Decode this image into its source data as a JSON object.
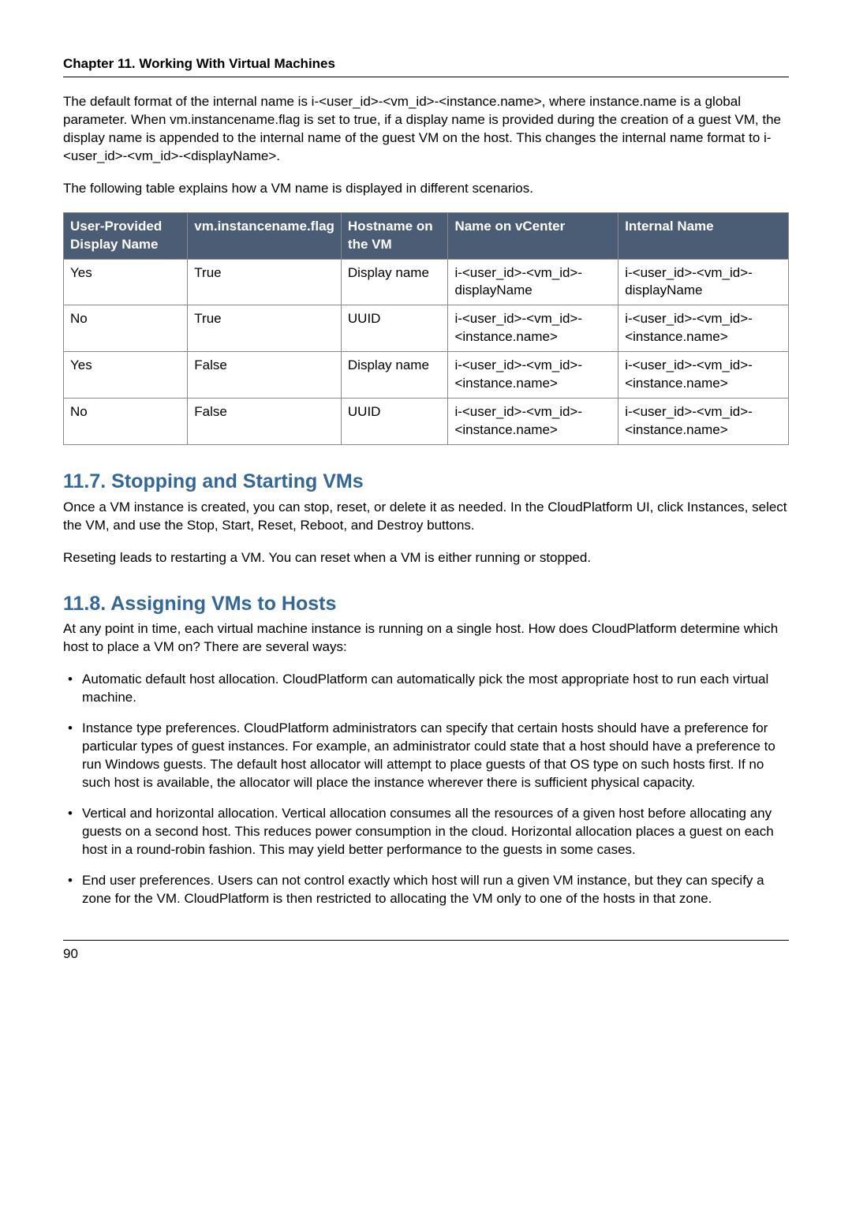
{
  "header": {
    "chapter": "Chapter 11. Working With Virtual Machines"
  },
  "intro": {
    "p1": "The default format of the internal name is i-<user_id>-<vm_id>-<instance.name>, where instance.name is a global parameter. When vm.instancename.flag is set to true, if a display name is provided during the creation of a guest VM, the display name is appended to the internal name of the guest VM on the host. This changes the internal name format to i-<user_id>-<vm_id>-<displayName>.",
    "p2": "The following table explains how a VM name is displayed in different scenarios."
  },
  "table": {
    "headers": {
      "c1": "User-Provided Display Name",
      "c2": "vm.instancename.flag",
      "c3": "Hostname on the VM",
      "c4": "Name on vCenter",
      "c5": "Internal Name"
    },
    "rows": [
      {
        "c1": "Yes",
        "c2": "True",
        "c3": "Display name",
        "c4": "i-<user_id>-<vm_id>-displayName",
        "c5": "i-<user_id>-<vm_id>-displayName"
      },
      {
        "c1": "No",
        "c2": "True",
        "c3": "UUID",
        "c4": "i-<user_id>-<vm_id>-<instance.name>",
        "c5": "i-<user_id>-<vm_id>-<instance.name>"
      },
      {
        "c1": "Yes",
        "c2": "False",
        "c3": "Display name",
        "c4": "i-<user_id>-<vm_id>-<instance.name>",
        "c5": "i-<user_id>-<vm_id>-<instance.name>"
      },
      {
        "c1": "No",
        "c2": "False",
        "c3": "UUID",
        "c4": "i-<user_id>-<vm_id>-<instance.name>",
        "c5": "i-<user_id>-<vm_id>-<instance.name>"
      }
    ]
  },
  "section7": {
    "title": "11.7. Stopping and Starting VMs",
    "p1": "Once a VM instance is created, you can stop, reset, or delete it as needed. In the CloudPlatform UI, click Instances, select the VM, and use the Stop, Start, Reset, Reboot, and Destroy buttons.",
    "p2": "Reseting leads to restarting a VM. You can reset when a VM is either running or stopped."
  },
  "section8": {
    "title": "11.8. Assigning VMs to Hosts",
    "p1": "At any point in time, each virtual machine instance is running on a single host. How does CloudPlatform determine which host to place a VM on? There are several ways:",
    "bullets": [
      "Automatic default host allocation. CloudPlatform can automatically pick the most appropriate host to run each virtual machine.",
      "Instance type preferences. CloudPlatform administrators can specify that certain hosts should have a preference for particular types of guest instances. For example, an administrator could state that a host should have a preference to run Windows guests. The default host allocator will attempt to place guests of that OS type on such hosts first. If no such host is available, the allocator will place the instance wherever there is sufficient physical capacity.",
      "Vertical and horizontal allocation. Vertical allocation consumes all the resources of a given host before allocating any guests on a second host. This reduces power consumption in the cloud. Horizontal allocation places a guest on each host in a round-robin fashion. This may yield better performance to the guests in some cases.",
      "End user preferences. Users can not control exactly which host will run a given VM instance, but they can specify a zone for the VM. CloudPlatform is then restricted to allocating the VM only to one of the hosts in that zone."
    ]
  },
  "footer": {
    "page": "90"
  }
}
